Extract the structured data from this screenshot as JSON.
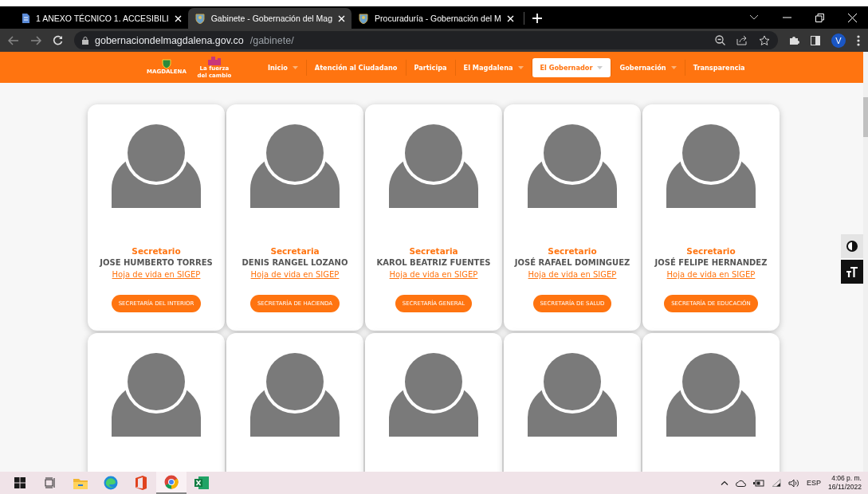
{
  "browser": {
    "tabs": [
      {
        "kind": "document",
        "title": "1 ANEXO TÉCNICO 1. ACCESIBILI",
        "selected": false
      },
      {
        "kind": "crest",
        "title": "Gabinete - Gobernación del Mag",
        "selected": true
      },
      {
        "kind": "crest",
        "title": "Procuraduría - Gobernación del M",
        "selected": false
      }
    ],
    "url_host": "gobernaciondelmagdalena.gov.co",
    "url_path": "/gabinete/",
    "profile": "V"
  },
  "site_nav": {
    "logo_lines": [
      "MAGDALENA",
      "La fuerza del cambio"
    ],
    "items": [
      {
        "label": "Inicio",
        "dropdown": true,
        "selected": false
      },
      {
        "label": "Atención al Ciudadano",
        "dropdown": false,
        "selected": false
      },
      {
        "label": "Participa",
        "dropdown": false,
        "selected": false
      },
      {
        "label": "El Magdalena",
        "dropdown": true,
        "selected": false
      },
      {
        "label": "El Gobernador",
        "dropdown": true,
        "selected": true
      },
      {
        "label": "Gobernación",
        "dropdown": true,
        "selected": false
      },
      {
        "label": "Transparencia",
        "dropdown": false,
        "selected": false
      }
    ]
  },
  "cards": [
    {
      "kind": "full",
      "role": "Secretario",
      "name": "JOSE HUMBERTO TORRES",
      "link": "Hoja de vida en SIGEP",
      "button": "SECRETARÍA DEL INTERIOR"
    },
    {
      "kind": "full",
      "role": "Secretaria",
      "name": "DENIS RANGEL LOZANO",
      "link": "Hoja de vida en SIGEP",
      "button": "SECRETARÍA DE HACIENDA"
    },
    {
      "kind": "full",
      "role": "Secretaria",
      "name": "KAROL BEATRIZ FUENTES",
      "link": "Hoja de vida en SIGEP",
      "button": "SECRETARÍA GENERAL"
    },
    {
      "kind": "full",
      "role": "Secretario",
      "name": "JOSÉ RAFAEL DOMINGUEZ",
      "link": "Hoja de vida en SIGEP",
      "button": "SECRETARÍA DE SALUD"
    },
    {
      "kind": "full",
      "role": "Secretario",
      "name": "JOSÉ FELIPE HERNANDEZ",
      "link": "Hoja de vida en SIGEP",
      "button": "SECRETARÍA DE EDUCACIÓN"
    },
    {
      "kind": "cut"
    },
    {
      "kind": "cut"
    },
    {
      "kind": "cut"
    },
    {
      "kind": "cut"
    },
    {
      "kind": "cut"
    }
  ],
  "taskbar": {
    "apps": [
      {
        "kind": "start",
        "selected": false
      },
      {
        "kind": "taskview",
        "selected": false
      },
      {
        "kind": "explorer",
        "selected": false
      },
      {
        "kind": "edge",
        "selected": false
      },
      {
        "kind": "office",
        "selected": false
      },
      {
        "kind": "chrome",
        "selected": true
      },
      {
        "kind": "excel",
        "selected": false
      }
    ],
    "language": "ESP",
    "time": "4:06 p. m.",
    "date": "16/11/2022"
  }
}
